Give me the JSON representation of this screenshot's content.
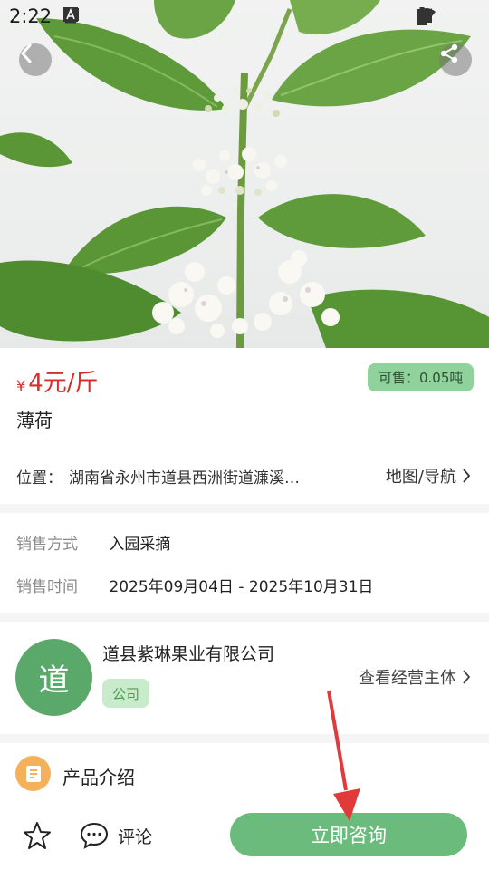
{
  "status_bar": {
    "time": "2:22",
    "icons_left": [
      "image-icon",
      "download-icon",
      "download-icon",
      "font-icon"
    ],
    "icons_right": [
      "wifi-icon",
      "signal-icon",
      "battery-icon"
    ]
  },
  "hero": {
    "image": "mint-plant-flowers-photo",
    "back_icon": "chevron-left-icon",
    "share_icon": "share-icon"
  },
  "product": {
    "currency_symbol": "¥",
    "price": "4元/斤",
    "stock": "可售：0.05吨",
    "name": "薄荷",
    "location_label": "位置：",
    "location_value": "湖南省永州市道县西洲街道濂溪…",
    "map_link": "地图/导航"
  },
  "sale_info": {
    "method_label": "销售方式",
    "method_value": "入园采摘",
    "time_label": "销售时间",
    "time_value": "2025年09月04日 - 2025年10月31日"
  },
  "company": {
    "avatar_char": "道",
    "name": "道县紫琳果业有限公司",
    "tag": "公司",
    "view_link": "查看经营主体"
  },
  "intro": {
    "label": "产品介绍",
    "icon": "document-icon"
  },
  "bottom_bar": {
    "favorite_icon": "star-icon",
    "comment_icon": "chat-bubble-icon",
    "comment_label": "评论",
    "consult_label": "立即咨询"
  },
  "colors": {
    "price": "#d5312a",
    "primary_green": "#6bbb7c",
    "stock_badge_bg": "#8fd29b",
    "tag_bg": "#c8ebcb",
    "avatar_bg": "#5aa96b",
    "intro_icon_bg": "#f6b05a",
    "annotation_arrow": "#e03a3a"
  }
}
